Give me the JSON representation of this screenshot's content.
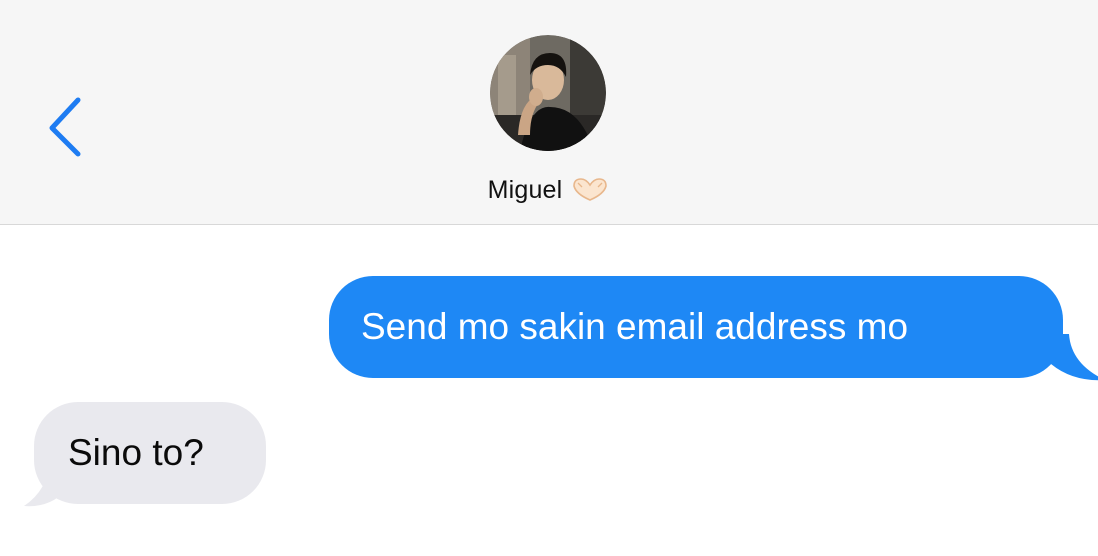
{
  "header": {
    "contact_name": "Miguel",
    "name_emoji": "heart-hands-icon",
    "back_icon": "chevron-left-icon",
    "avatar": "contact-photo"
  },
  "colors": {
    "accent_blue": "#1e88f5",
    "incoming_bubble": "#e9e9ee",
    "header_bg": "#f6f6f6"
  },
  "messages": [
    {
      "direction": "outgoing",
      "text": "Send mo sakin email address mo"
    },
    {
      "direction": "incoming",
      "text": "Sino to?"
    }
  ]
}
